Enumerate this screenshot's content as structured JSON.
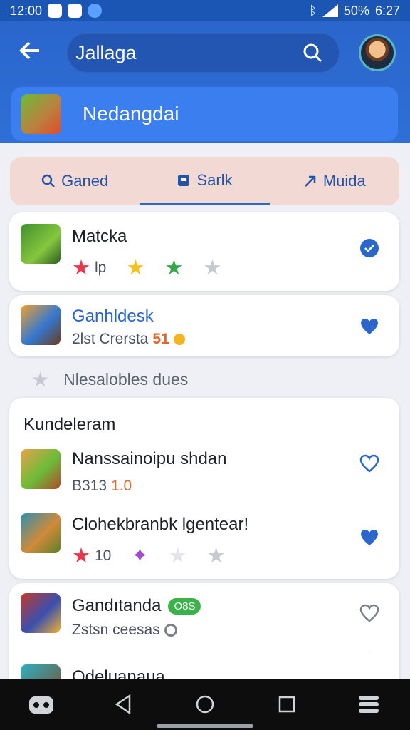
{
  "status_bar": {
    "time_left": "12:00",
    "battery": "50%",
    "time_right": "6:27"
  },
  "app_bar": {
    "search_value": "Jallaga"
  },
  "banner": {
    "title": "Nedangdai"
  },
  "tabs": [
    {
      "label": "Ganed",
      "icon": "search-icon",
      "active": false
    },
    {
      "label": "Sarlk",
      "icon": "gamepad-icon",
      "active": true
    },
    {
      "label": "Muida",
      "icon": "arrow-icon",
      "active": false
    }
  ],
  "card1": {
    "title": "Matcka",
    "rating_text": "lp",
    "star_colors": [
      "#e5384a",
      "#f4c21f",
      "#38a84a",
      "#c6c9cf"
    ]
  },
  "card2": {
    "title": "Ganhldesk",
    "subtitle": "2lst Crersta",
    "subtitle_number": "51"
  },
  "note": {
    "text": "Nlesalobles dues"
  },
  "section": {
    "title": "Kundeleram",
    "items": [
      {
        "title": "Nanssainoipu shdan",
        "subtitle": "B313",
        "subtitle_extra": "1.0"
      },
      {
        "title": "Clohekbranbk lgentear!",
        "rating_text": "10"
      }
    ]
  },
  "card4": {
    "items": [
      {
        "title": "Gandıtanda",
        "badge": "O8S",
        "subtitle": "Zstsn ceesas"
      },
      {
        "title": "Odeluanaua"
      }
    ]
  },
  "colors": {
    "primary": "#2a66cc",
    "banner": "#3a7ef0",
    "tabs_bg": "#f2d9d4",
    "heart": "#2a66cc"
  }
}
